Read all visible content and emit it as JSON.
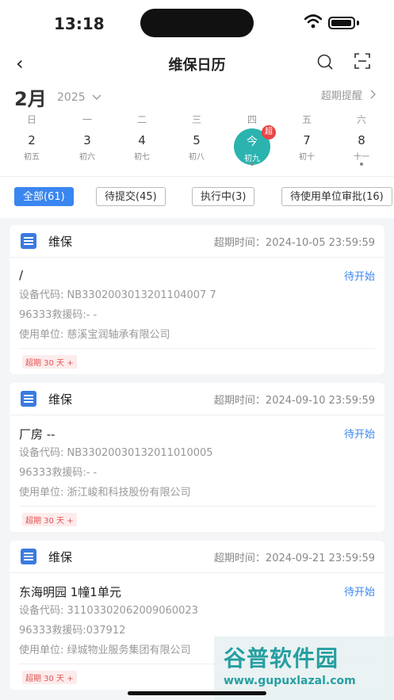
{
  "status_bar": {
    "time": "13:18"
  },
  "nav": {
    "back": "‹",
    "title": "维保日历"
  },
  "calendar": {
    "month": "2月",
    "year": "2025",
    "overdue_remind": "超期提醒",
    "weekdays": [
      "日",
      "一",
      "二",
      "三",
      "四",
      "五",
      "六"
    ],
    "days": [
      {
        "num": "2",
        "lunar": "初五"
      },
      {
        "num": "3",
        "lunar": "初六"
      },
      {
        "num": "4",
        "lunar": "初七"
      },
      {
        "num": "5",
        "lunar": "初八"
      },
      {
        "num": "今",
        "lunar": "初九"
      },
      {
        "num": "7",
        "lunar": "初十"
      },
      {
        "num": "8",
        "lunar": "十一"
      }
    ],
    "today_badge": "超"
  },
  "filters": [
    "全部(61)",
    "待提交(45)",
    "执行中(3)",
    "待使用单位审批(16)"
  ],
  "cards": [
    {
      "type": "维保",
      "deadline": "超期时间：2024-10-05 23:59:59",
      "name": "/",
      "status": "待开始",
      "device_code": "设备代码: NB3302003013201104007 7",
      "rescue_code": "96333救援码:- -",
      "unit": "使用单位: 慈溪宝润轴承有限公司",
      "overdue": "超期 30 天 +"
    },
    {
      "type": "维保",
      "deadline": "超期时间：2024-09-10 23:59:59",
      "name": "厂房 --",
      "status": "待开始",
      "device_code": "设备代码: NB33020030132011010005",
      "rescue_code": "96333救援码:- -",
      "unit": "使用单位: 浙江峻和科技股份有限公司",
      "overdue": "超期 30 天 +"
    },
    {
      "type": "维保",
      "deadline": "超期时间：2024-09-21 23:59:59",
      "name": "东海明园 1幢1单元",
      "status": "待开始",
      "device_code": "设备代码: 31103302062009060023",
      "rescue_code": "96333救援码:037912",
      "unit": "使用单位: 绿城物业服务集团有限公司",
      "overdue": "超期 30 天 +"
    }
  ],
  "watermark": {
    "brand": "谷普软件园",
    "url": "www.gupuxlazal.com"
  }
}
